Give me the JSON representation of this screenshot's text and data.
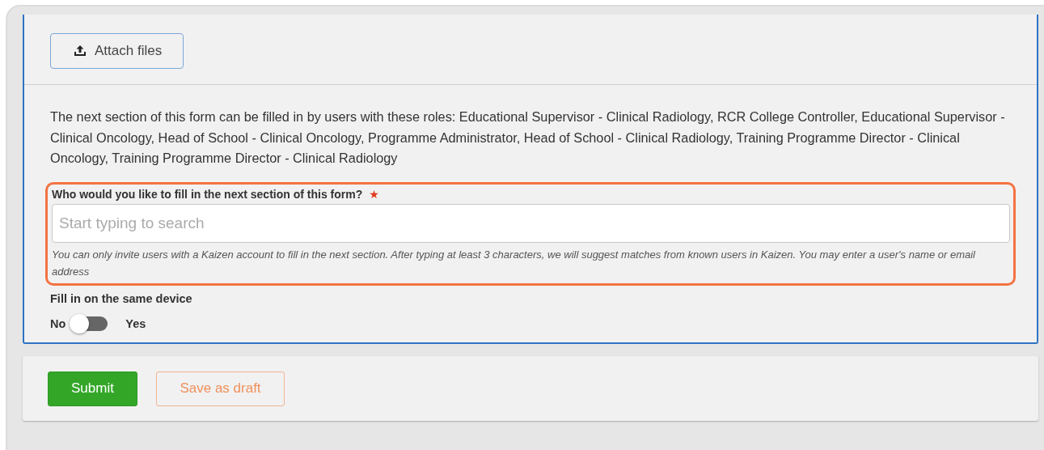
{
  "attach_button": {
    "label": "Attach files"
  },
  "roles_text": "The next section of this form can be filled in by users with these roles: Educational Supervisor - Clinical Radiology, RCR College Controller, Educational Supervisor - Clinical Oncology, Head of School - Clinical Oncology, Programme Administrator, Head of School - Clinical Radiology, Training Programme Director - Clinical Oncology, Training Programme Director - Clinical Radiology",
  "invite_field": {
    "label": "Who would you like to fill in the next section of this form?",
    "required": true,
    "required_mark": "★",
    "placeholder": "Start typing to search",
    "help": "You can only invite users with a Kaizen account to fill in the next section. After typing at least 3 characters, we will suggest matches from known users in Kaizen. You may enter a user's name or email address",
    "highlighted": true
  },
  "same_device": {
    "label": "Fill in on the same device",
    "off_label": "No",
    "on_label": "Yes",
    "on": false
  },
  "buttons": [
    {
      "label": "Submit",
      "kind": "primary"
    },
    {
      "label": "Save as draft",
      "kind": "outline"
    }
  ]
}
